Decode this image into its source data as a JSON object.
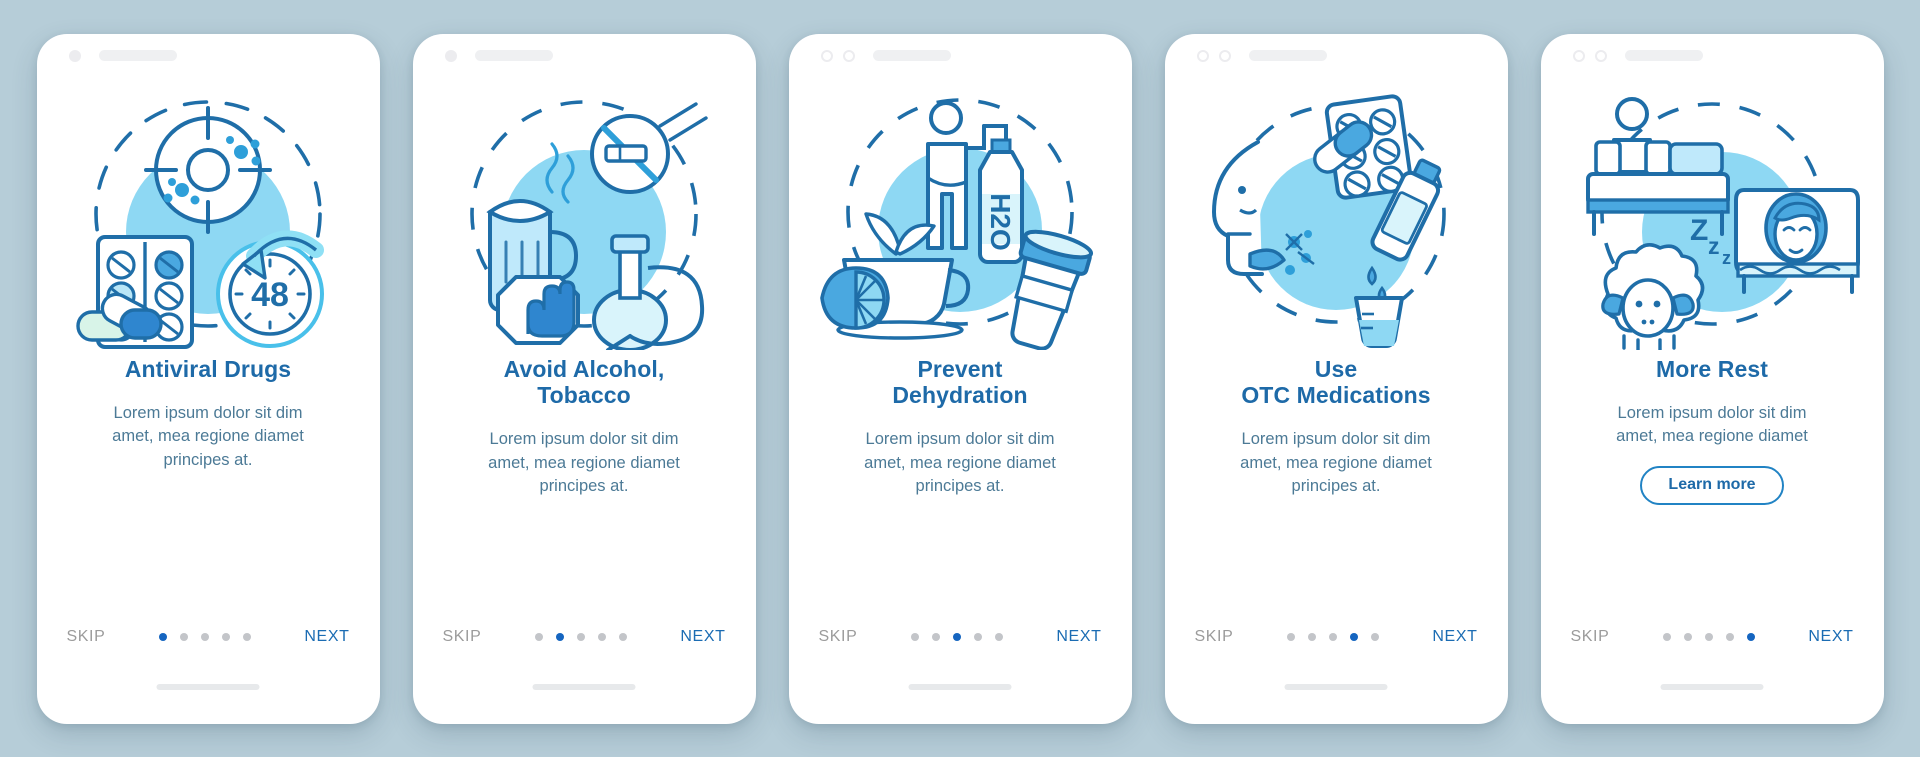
{
  "page": {
    "background_color": "#b6cdd8",
    "accent_color": "#1e6aa8",
    "next_color": "#1b6cb3",
    "skip_color": "#9b9b9b",
    "dot_active_color": "#1565c0",
    "dot_inactive_color": "#c3c5c9",
    "body_color": "#4c7a96",
    "illustration_circle_color": "#8ed8f3"
  },
  "nav": {
    "skip_label": "SKIP",
    "next_label": "NEXT",
    "dot_count": 5
  },
  "screens": [
    {
      "title": "Antiviral Drugs",
      "body": "Lorem ipsum dolor sit dim\namet, mea regione diamet\nprincipes at.",
      "active_dot": 1,
      "status_icons": [
        "camera-dot",
        "speaker-bar"
      ],
      "illustration": "antiviral-drugs-illustration",
      "illustration_label": "48",
      "cta": null
    },
    {
      "title": "Avoid Alcohol,\nTobacco",
      "body": "Lorem ipsum dolor sit dim\namet, mea regione diamet\nprincipes at.",
      "active_dot": 2,
      "status_icons": [
        "camera-dot",
        "speaker-bar"
      ],
      "illustration": "avoid-alcohol-tobacco-illustration",
      "illustration_label": "",
      "cta": null
    },
    {
      "title": "Prevent\nDehydration",
      "body": "Lorem ipsum dolor sit dim\namet, mea regione diamet\nprincipes at.",
      "active_dot": 3,
      "status_icons": [
        "camera-ring",
        "camera-ring",
        "speaker-bar"
      ],
      "illustration": "prevent-dehydration-illustration",
      "illustration_label": "H2O",
      "cta": null
    },
    {
      "title": "Use\nOTC Medications",
      "body": "Lorem ipsum dolor sit dim\namet, mea regione diamet\nprincipes at.",
      "active_dot": 4,
      "status_icons": [
        "camera-ring",
        "camera-ring",
        "speaker-bar"
      ],
      "illustration": "otc-medications-illustration",
      "illustration_label": "",
      "cta": null
    },
    {
      "title": "More Rest",
      "body": "Lorem ipsum dolor sit dim\namet, mea regione diamet",
      "active_dot": 5,
      "status_icons": [
        "camera-ring",
        "camera-ring",
        "speaker-bar"
      ],
      "illustration": "more-rest-illustration",
      "illustration_label": "Zzz",
      "cta": "Learn more"
    }
  ]
}
